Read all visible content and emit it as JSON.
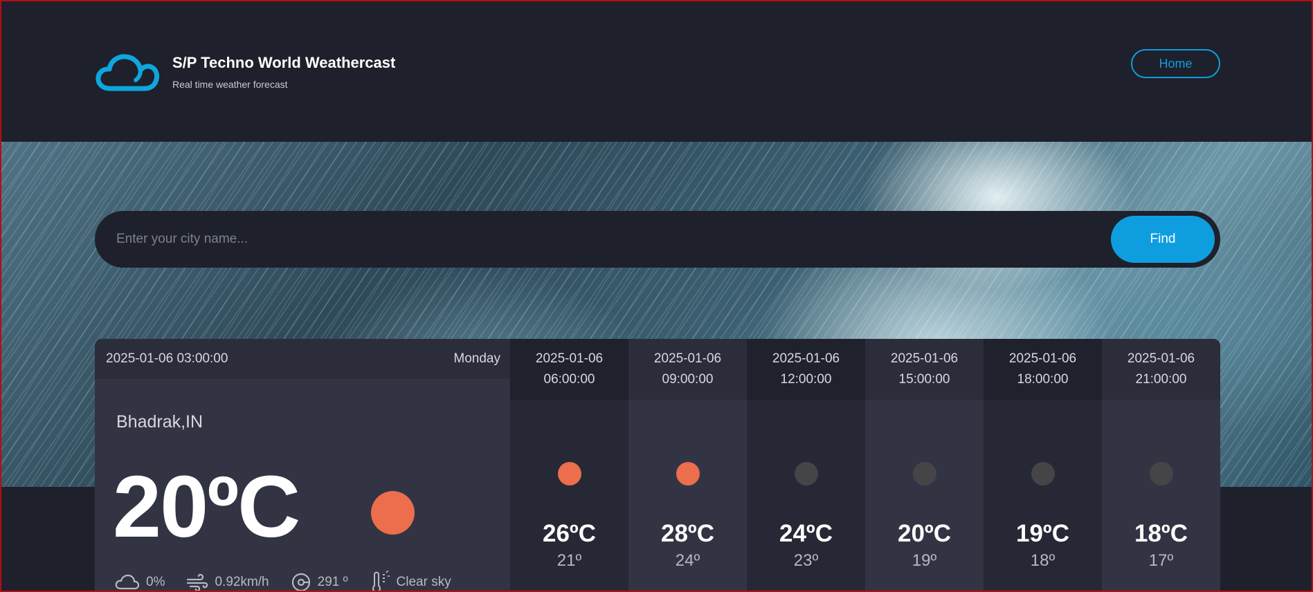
{
  "header": {
    "title": "S/P Techno World Weathercast",
    "subtitle": "Real time weather forecast",
    "home_label": "Home",
    "logo_icon": "cloud-icon",
    "accent_color": "#0e9ee0"
  },
  "search": {
    "placeholder": "Enter your city name...",
    "value": "",
    "button_label": "Find"
  },
  "current": {
    "datetime": "2025-01-06 03:00:00",
    "day": "Monday",
    "city": "Bhadrak,IN",
    "temperature": "20ºC",
    "condition_color": "#ec6e4c",
    "cloudiness": "0%",
    "wind": "0.92km/h",
    "direction": "291 º",
    "description": "Clear sky"
  },
  "hourly": [
    {
      "date": "2025-01-06",
      "time": "06:00:00",
      "max": "26ºC",
      "min": "21º",
      "icon_color": "#ec6e4c"
    },
    {
      "date": "2025-01-06",
      "time": "09:00:00",
      "max": "28ºC",
      "min": "24º",
      "icon_color": "#ec6e4c"
    },
    {
      "date": "2025-01-06",
      "time": "12:00:00",
      "max": "24ºC",
      "min": "23º",
      "icon_color": "#454548"
    },
    {
      "date": "2025-01-06",
      "time": "15:00:00",
      "max": "20ºC",
      "min": "19º",
      "icon_color": "#454548"
    },
    {
      "date": "2025-01-06",
      "time": "18:00:00",
      "max": "19ºC",
      "min": "18º",
      "icon_color": "#454548"
    },
    {
      "date": "2025-01-06",
      "time": "21:00:00",
      "max": "18ºC",
      "min": "17º",
      "icon_color": "#454548"
    }
  ]
}
